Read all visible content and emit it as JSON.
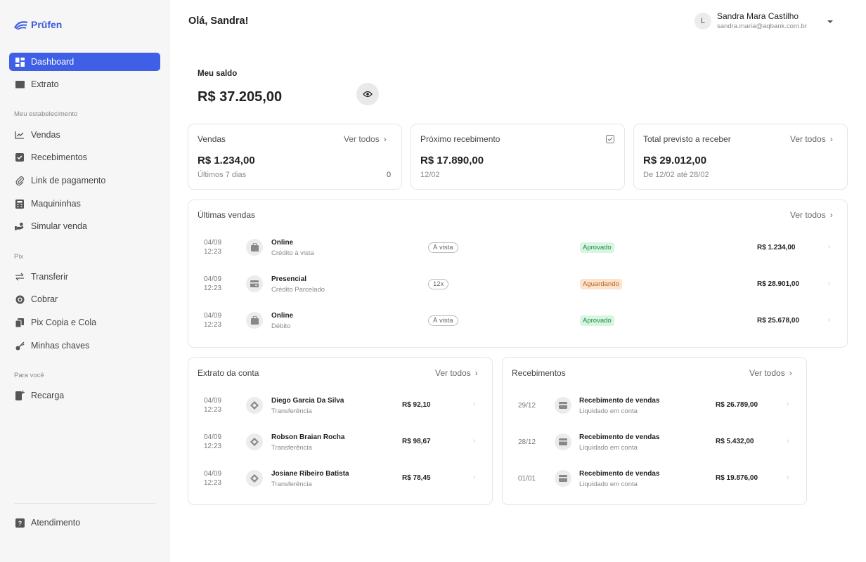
{
  "brand": {
    "name": "Prūfen",
    "color": "#3f5fe6"
  },
  "sidebar": {
    "items": [
      {
        "label": "Dashboard",
        "icon": "grid-icon",
        "active": true
      },
      {
        "label": "Extrato",
        "icon": "statement-icon"
      },
      {
        "label": "Vendas",
        "icon": "chart-line-icon"
      },
      {
        "label": "Recebimentos",
        "icon": "check-square-icon"
      },
      {
        "label": "Link de pagamento",
        "icon": "paperclip-icon"
      },
      {
        "label": "Maquininhas",
        "icon": "calculator-icon"
      },
      {
        "label": "Simular venda",
        "icon": "hand-coin-icon"
      },
      {
        "label": "Transferir",
        "icon": "arrows-swap-icon"
      },
      {
        "label": "Cobrar",
        "icon": "coin-icon"
      },
      {
        "label": "Pix Copia e Cola",
        "icon": "copy-icon"
      },
      {
        "label": "Minhas chaves",
        "icon": "key-icon"
      },
      {
        "label": "Recarga",
        "icon": "phone-plus-icon"
      },
      {
        "label": "Atendimento",
        "icon": "help-icon"
      }
    ],
    "sections": [
      "Meu estabelecimento",
      "Pix",
      "Para você"
    ]
  },
  "header": {
    "greeting": "Olá, Sandra!",
    "user": {
      "initial": "L",
      "name": "Sandra Mara Castilho",
      "email": "sandra.maria@aqbank.com.br"
    }
  },
  "balance": {
    "label": "Meu saldo",
    "value": "R$ 37.205,00"
  },
  "ver_todos": "Ver todos",
  "summary": {
    "vendas": {
      "title": "Vendas",
      "value": "R$ 1.234,00",
      "sub": "Últimos 7 dias",
      "count": "0"
    },
    "proximo": {
      "title": "Próximo recebimento",
      "value": "R$ 17.890,00",
      "sub": "12/02"
    },
    "previsto": {
      "title": "Total previsto a receber",
      "value": "R$ 29.012,00",
      "sub": "De 12/02 até 28/02"
    }
  },
  "ultimas_vendas": {
    "title": "Últimas vendas",
    "rows": [
      {
        "date": "04/09",
        "time": "12:23",
        "title": "Online",
        "sub": "Crédito à vista",
        "pill": "À vista",
        "status": "Aprovado",
        "amount": "R$ 1.234,00"
      },
      {
        "date": "04/09",
        "time": "12:23",
        "title": "Presencial",
        "sub": "Crédito Parcelado",
        "pill": "12x",
        "status": "Aguardando",
        "amount": "R$ 28.901,00"
      },
      {
        "date": "04/09",
        "time": "12:23",
        "title": "Online",
        "sub": "Débito",
        "pill": "À vista",
        "status": "Aprovado",
        "amount": "R$ 25.678,00"
      }
    ]
  },
  "extrato": {
    "title": "Extrato da conta",
    "rows": [
      {
        "date": "04/09",
        "time": "12:23",
        "title": "Diego Garcia Da Silva",
        "sub": "Transferência",
        "amount": "R$ 92,10"
      },
      {
        "date": "04/09",
        "time": "12:23",
        "title": "Robson Braian Rocha",
        "sub": "Transferência",
        "amount": "R$ 98,67"
      },
      {
        "date": "04/09",
        "time": "12:23",
        "title": "Josiane Ribeiro Batista",
        "sub": "Transferência",
        "amount": "R$ 78,45"
      }
    ]
  },
  "recebimentos": {
    "title": "Recebimentos",
    "rows": [
      {
        "date": "29/12",
        "title": "Recebimento de vendas",
        "sub": "Liquidado em conta",
        "amount": "R$ 26.789,00"
      },
      {
        "date": "28/12",
        "title": "Recebimento de vendas",
        "sub": "Liquidado em conta",
        "amount": "R$ 5.432,00"
      },
      {
        "date": "01/01",
        "title": "Recebimento de vendas",
        "sub": "Liquidado em conta",
        "amount": "R$ 19.876,00"
      }
    ]
  }
}
